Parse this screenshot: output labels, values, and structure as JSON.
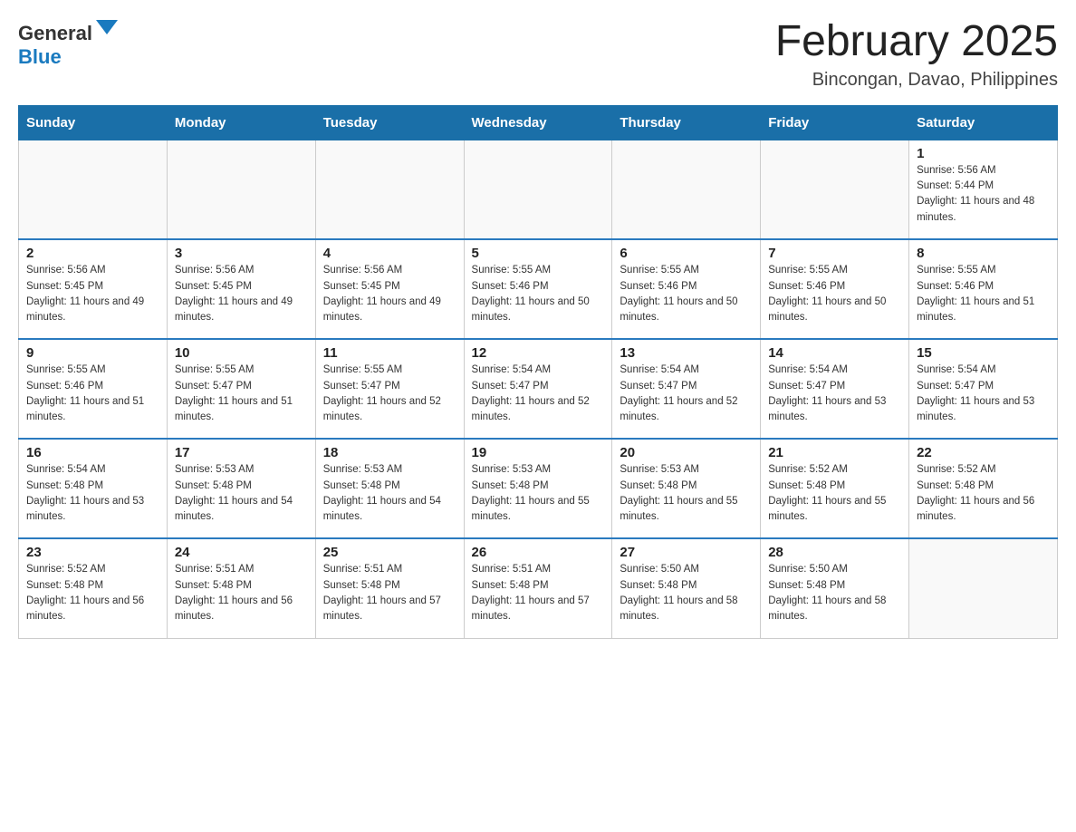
{
  "logo": {
    "text_general": "General",
    "text_blue": "Blue"
  },
  "header": {
    "month_year": "February 2025",
    "location": "Bincongan, Davao, Philippines"
  },
  "days_of_week": [
    "Sunday",
    "Monday",
    "Tuesday",
    "Wednesday",
    "Thursday",
    "Friday",
    "Saturday"
  ],
  "weeks": [
    [
      {
        "day": "",
        "info": ""
      },
      {
        "day": "",
        "info": ""
      },
      {
        "day": "",
        "info": ""
      },
      {
        "day": "",
        "info": ""
      },
      {
        "day": "",
        "info": ""
      },
      {
        "day": "",
        "info": ""
      },
      {
        "day": "1",
        "info": "Sunrise: 5:56 AM\nSunset: 5:44 PM\nDaylight: 11 hours and 48 minutes."
      }
    ],
    [
      {
        "day": "2",
        "info": "Sunrise: 5:56 AM\nSunset: 5:45 PM\nDaylight: 11 hours and 49 minutes."
      },
      {
        "day": "3",
        "info": "Sunrise: 5:56 AM\nSunset: 5:45 PM\nDaylight: 11 hours and 49 minutes."
      },
      {
        "day": "4",
        "info": "Sunrise: 5:56 AM\nSunset: 5:45 PM\nDaylight: 11 hours and 49 minutes."
      },
      {
        "day": "5",
        "info": "Sunrise: 5:55 AM\nSunset: 5:46 PM\nDaylight: 11 hours and 50 minutes."
      },
      {
        "day": "6",
        "info": "Sunrise: 5:55 AM\nSunset: 5:46 PM\nDaylight: 11 hours and 50 minutes."
      },
      {
        "day": "7",
        "info": "Sunrise: 5:55 AM\nSunset: 5:46 PM\nDaylight: 11 hours and 50 minutes."
      },
      {
        "day": "8",
        "info": "Sunrise: 5:55 AM\nSunset: 5:46 PM\nDaylight: 11 hours and 51 minutes."
      }
    ],
    [
      {
        "day": "9",
        "info": "Sunrise: 5:55 AM\nSunset: 5:46 PM\nDaylight: 11 hours and 51 minutes."
      },
      {
        "day": "10",
        "info": "Sunrise: 5:55 AM\nSunset: 5:47 PM\nDaylight: 11 hours and 51 minutes."
      },
      {
        "day": "11",
        "info": "Sunrise: 5:55 AM\nSunset: 5:47 PM\nDaylight: 11 hours and 52 minutes."
      },
      {
        "day": "12",
        "info": "Sunrise: 5:54 AM\nSunset: 5:47 PM\nDaylight: 11 hours and 52 minutes."
      },
      {
        "day": "13",
        "info": "Sunrise: 5:54 AM\nSunset: 5:47 PM\nDaylight: 11 hours and 52 minutes."
      },
      {
        "day": "14",
        "info": "Sunrise: 5:54 AM\nSunset: 5:47 PM\nDaylight: 11 hours and 53 minutes."
      },
      {
        "day": "15",
        "info": "Sunrise: 5:54 AM\nSunset: 5:47 PM\nDaylight: 11 hours and 53 minutes."
      }
    ],
    [
      {
        "day": "16",
        "info": "Sunrise: 5:54 AM\nSunset: 5:48 PM\nDaylight: 11 hours and 53 minutes."
      },
      {
        "day": "17",
        "info": "Sunrise: 5:53 AM\nSunset: 5:48 PM\nDaylight: 11 hours and 54 minutes."
      },
      {
        "day": "18",
        "info": "Sunrise: 5:53 AM\nSunset: 5:48 PM\nDaylight: 11 hours and 54 minutes."
      },
      {
        "day": "19",
        "info": "Sunrise: 5:53 AM\nSunset: 5:48 PM\nDaylight: 11 hours and 55 minutes."
      },
      {
        "day": "20",
        "info": "Sunrise: 5:53 AM\nSunset: 5:48 PM\nDaylight: 11 hours and 55 minutes."
      },
      {
        "day": "21",
        "info": "Sunrise: 5:52 AM\nSunset: 5:48 PM\nDaylight: 11 hours and 55 minutes."
      },
      {
        "day": "22",
        "info": "Sunrise: 5:52 AM\nSunset: 5:48 PM\nDaylight: 11 hours and 56 minutes."
      }
    ],
    [
      {
        "day": "23",
        "info": "Sunrise: 5:52 AM\nSunset: 5:48 PM\nDaylight: 11 hours and 56 minutes."
      },
      {
        "day": "24",
        "info": "Sunrise: 5:51 AM\nSunset: 5:48 PM\nDaylight: 11 hours and 56 minutes."
      },
      {
        "day": "25",
        "info": "Sunrise: 5:51 AM\nSunset: 5:48 PM\nDaylight: 11 hours and 57 minutes."
      },
      {
        "day": "26",
        "info": "Sunrise: 5:51 AM\nSunset: 5:48 PM\nDaylight: 11 hours and 57 minutes."
      },
      {
        "day": "27",
        "info": "Sunrise: 5:50 AM\nSunset: 5:48 PM\nDaylight: 11 hours and 58 minutes."
      },
      {
        "day": "28",
        "info": "Sunrise: 5:50 AM\nSunset: 5:48 PM\nDaylight: 11 hours and 58 minutes."
      },
      {
        "day": "",
        "info": ""
      }
    ]
  ]
}
